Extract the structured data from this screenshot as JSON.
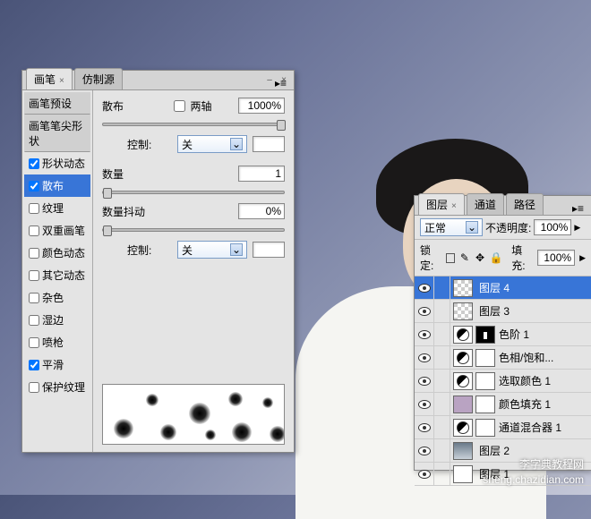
{
  "brush_panel": {
    "tabs": [
      {
        "label": "画笔",
        "active": true
      },
      {
        "label": "仿制源",
        "active": false
      }
    ],
    "sidebar": {
      "preset": "画笔预设",
      "tip_shape": "画笔笔尖形状",
      "items": [
        {
          "label": "形状动态",
          "checked": true,
          "selected": false
        },
        {
          "label": "散布",
          "checked": true,
          "selected": true
        },
        {
          "label": "纹理",
          "checked": false,
          "selected": false
        },
        {
          "label": "双重画笔",
          "checked": false,
          "selected": false
        },
        {
          "label": "颜色动态",
          "checked": false,
          "selected": false
        },
        {
          "label": "其它动态",
          "checked": false,
          "selected": false
        },
        {
          "label": "杂色",
          "checked": false,
          "selected": false
        },
        {
          "label": "湿边",
          "checked": false,
          "selected": false
        },
        {
          "label": "喷枪",
          "checked": false,
          "selected": false
        },
        {
          "label": "平滑",
          "checked": true,
          "selected": false
        },
        {
          "label": "保护纹理",
          "checked": false,
          "selected": false
        }
      ]
    },
    "settings": {
      "scatter_label": "散布",
      "both_axes_label": "两轴",
      "both_axes_checked": false,
      "scatter_value": "1000%",
      "control1_label": "控制:",
      "control1_value": "关",
      "count_label": "数量",
      "count_value": "1",
      "count_jitter_label": "数量抖动",
      "count_jitter_value": "0%",
      "control2_label": "控制:",
      "control2_value": "关"
    }
  },
  "layers_panel": {
    "tabs": [
      {
        "label": "图层",
        "active": true
      },
      {
        "label": "通道",
        "active": false
      },
      {
        "label": "路径",
        "active": false
      }
    ],
    "blend_mode": "正常",
    "opacity_label": "不透明度:",
    "opacity_value": "100%",
    "lock_label": "锁定:",
    "fill_label": "填充:",
    "fill_value": "100%",
    "layers": [
      {
        "name": "图层 4",
        "type": "normal",
        "selected": true,
        "trans": true
      },
      {
        "name": "图层 3",
        "type": "normal",
        "selected": false,
        "trans": true
      },
      {
        "name": "色阶 1",
        "type": "adjustment",
        "selected": false,
        "mask": "black"
      },
      {
        "name": "色相/饱和...",
        "type": "adjustment",
        "selected": false,
        "mask": "white"
      },
      {
        "name": "选取颜色 1",
        "type": "adjustment",
        "selected": false,
        "mask": "white"
      },
      {
        "name": "颜色填充 1",
        "type": "fill",
        "selected": false,
        "fill_color": "#b9a3c2"
      },
      {
        "name": "通道混合器 1",
        "type": "adjustment",
        "selected": false,
        "mask": "white"
      },
      {
        "name": "图层 2",
        "type": "normal",
        "selected": false,
        "trans": false,
        "photo": true
      },
      {
        "name": "图层 1",
        "type": "normal",
        "selected": false,
        "trans": false
      }
    ]
  },
  "watermark": {
    "line1": "李字典教程网",
    "line2": "sheng.chazidian.com"
  }
}
